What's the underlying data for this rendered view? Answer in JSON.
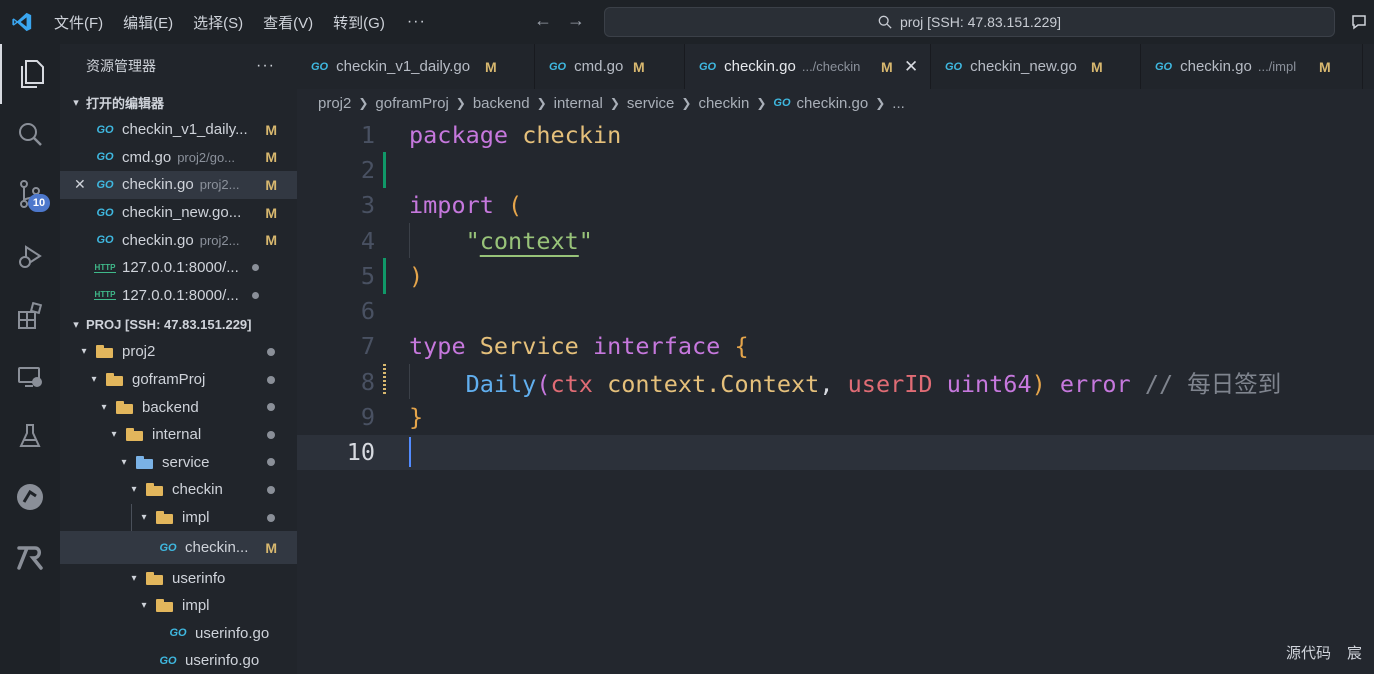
{
  "titlebar": {
    "menu": [
      "文件(F)",
      "编辑(E)",
      "选择(S)",
      "查看(V)",
      "转到(G)"
    ],
    "more": "···",
    "search_text": "proj [SSH: 47.83.151.229]"
  },
  "activity": {
    "scm_badge": "10"
  },
  "sidebar": {
    "title": "资源管理器",
    "more": "···",
    "open_editors_header": "打开的编辑器",
    "open_editors": [
      {
        "icon": "GO",
        "name": "checkin_v1_daily...",
        "desc": "",
        "status": "M"
      },
      {
        "icon": "GO",
        "name": "cmd.go",
        "desc": "proj2/go...",
        "status": "M"
      },
      {
        "icon": "GO",
        "name": "checkin.go",
        "desc": "proj2...",
        "status": "M"
      },
      {
        "icon": "GO",
        "name": "checkin_new.go...",
        "desc": "",
        "status": "M"
      },
      {
        "icon": "GO",
        "name": "checkin.go",
        "desc": "proj2...",
        "status": "M"
      },
      {
        "icon": "HTTP",
        "name": "127.0.0.1:8000/...",
        "desc": "",
        "status": ""
      },
      {
        "icon": "HTTP",
        "name": "127.0.0.1:8000/...",
        "desc": "",
        "status": ""
      }
    ],
    "project_header": "PROJ [SSH: 47.83.151.229]",
    "tree": [
      {
        "name": "proj2"
      },
      {
        "name": "goframProj"
      },
      {
        "name": "backend"
      },
      {
        "name": "internal"
      },
      {
        "name": "service"
      },
      {
        "name": "checkin"
      },
      {
        "name": "impl"
      },
      {
        "name": "checkin...",
        "status": "M"
      },
      {
        "name": "userinfo"
      },
      {
        "name": "impl"
      },
      {
        "name": "userinfo.go"
      },
      {
        "name": "userinfo.go"
      }
    ]
  },
  "tabs": [
    {
      "name": "checkin_v1_daily.go",
      "desc": "",
      "status": "M"
    },
    {
      "name": "cmd.go",
      "desc": "",
      "status": "M"
    },
    {
      "name": "checkin.go",
      "desc": ".../checkin",
      "status": "M"
    },
    {
      "name": "checkin_new.go",
      "desc": "",
      "status": "M"
    },
    {
      "name": "checkin.go",
      "desc": ".../impl",
      "status": "M"
    }
  ],
  "breadcrumb": [
    "proj2",
    "goframProj",
    "backend",
    "internal",
    "service",
    "checkin",
    "checkin.go",
    "..."
  ],
  "editor": {
    "line_numbers": [
      "1",
      "2",
      "3",
      "4",
      "5",
      "6",
      "7",
      "8",
      "9",
      "10"
    ],
    "l1": {
      "kw": "package",
      "name": "checkin"
    },
    "l3": {
      "kw": "import",
      "paren": "("
    },
    "l4": {
      "q1": "\"",
      "str": "context",
      "q2": "\""
    },
    "l5": {
      "paren": ")"
    },
    "l7": {
      "kw": "type",
      "name": "Service",
      "kw2": "interface",
      "brace": "{"
    },
    "l8": {
      "fn": "Daily",
      "open": "(",
      "p1": "ctx",
      "t1": "context.Context",
      "comma": ",",
      "p2": "userID",
      "t2": "uint64",
      "close": ")",
      "ret": "error",
      "comment": "// 每日签到"
    },
    "l9": {
      "brace": "}"
    }
  },
  "status": {
    "item1": "源代码",
    "item2": "宸"
  },
  "colors": {
    "accent": "#528bff",
    "modified": "#d8b86f",
    "go_icon": "#3fb8e0"
  }
}
